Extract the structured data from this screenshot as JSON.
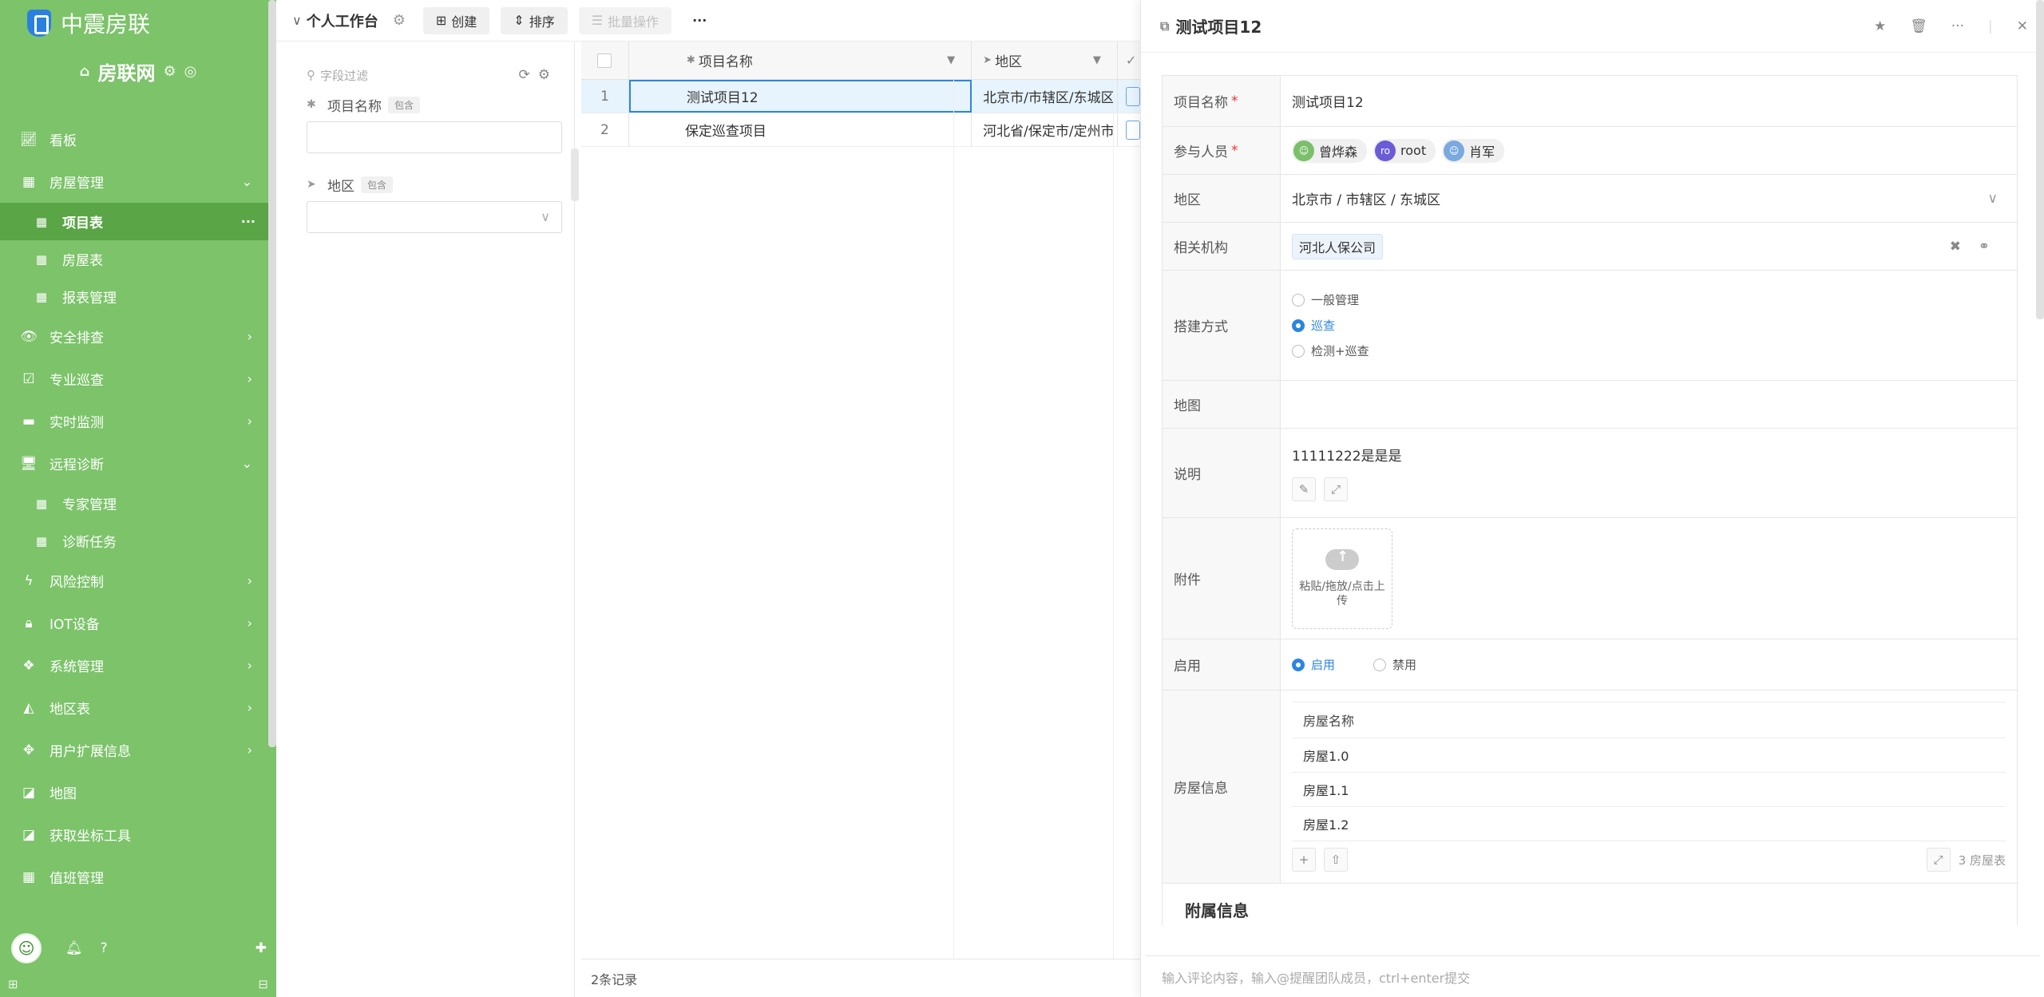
{
  "brand": {
    "name": "中震房联",
    "site": "房联网"
  },
  "sidebar": {
    "items": [
      {
        "label": "看板",
        "icon": "chart-line-icon"
      },
      {
        "label": "房屋管理",
        "icon": "calendar-icon",
        "arrow": "∨"
      },
      {
        "label": "项目表",
        "icon": "table-icon",
        "sub": true,
        "active": true
      },
      {
        "label": "房屋表",
        "icon": "table-icon",
        "sub": true
      },
      {
        "label": "报表管理",
        "icon": "table-icon",
        "sub": true
      },
      {
        "label": "安全排查",
        "icon": "eye-icon",
        "arrow": ">"
      },
      {
        "label": "专业巡查",
        "icon": "calendar-check-icon",
        "arrow": ">"
      },
      {
        "label": "实时监测",
        "icon": "monitor-icon",
        "arrow": ">"
      },
      {
        "label": "远程诊断",
        "icon": "desktop-icon",
        "arrow": "∨"
      },
      {
        "label": "专家管理",
        "icon": "table-icon",
        "sub": true
      },
      {
        "label": "诊断任务",
        "icon": "table-icon",
        "sub": true
      },
      {
        "label": "风险控制",
        "icon": "bolt-icon",
        "arrow": ">"
      },
      {
        "label": "IOT设备",
        "icon": "lock-icon",
        "arrow": ">"
      },
      {
        "label": "系统管理",
        "icon": "cubes-icon",
        "arrow": ">"
      },
      {
        "label": "地区表",
        "icon": "area-chart-icon",
        "arrow": ">"
      },
      {
        "label": "用户扩展信息",
        "icon": "arrows-icon",
        "arrow": ">"
      },
      {
        "label": "地图",
        "icon": "map-icon"
      },
      {
        "label": "获取坐标工具",
        "icon": "map-icon"
      },
      {
        "label": "值班管理",
        "icon": "table-icon"
      }
    ]
  },
  "toolbar": {
    "title": "个人工作台",
    "create": "创建",
    "sort": "排序",
    "batch": "批量操作",
    "more": "···"
  },
  "filter": {
    "placeholder": "字段过滤",
    "field1": {
      "label": "项目名称",
      "tag": "包含"
    },
    "field2": {
      "label": "地区",
      "tag": "包含"
    }
  },
  "grid": {
    "columns": [
      "项目名称",
      "地区"
    ],
    "rows": [
      {
        "no": "1",
        "name": "测试项目12",
        "region": "北京市/市辖区/东城区"
      },
      {
        "no": "2",
        "name": "保定巡查项目",
        "region": "河北省/保定市/定州市"
      }
    ],
    "footer": "2条记录"
  },
  "detail": {
    "title": "测试项目12",
    "labels": {
      "name": "项目名称",
      "members": "参与人员",
      "region": "地区",
      "org": "相关机构",
      "mode": "搭建方式",
      "map": "地图",
      "desc": "说明",
      "attach": "附件",
      "enable": "启用",
      "houses": "房屋信息"
    },
    "name": "测试项目12",
    "members": [
      {
        "name": "曾烨森",
        "color": "#7bbf6a",
        "initials": ""
      },
      {
        "name": "root",
        "color": "#6b5bd6",
        "initials": "ro"
      },
      {
        "name": "肖军",
        "color": "#7aa8e0",
        "initials": ""
      }
    ],
    "region": "北京市 / 市辖区 / 东城区",
    "org": "河北人保公司",
    "mode_options": [
      "一般管理",
      "巡查",
      "检测+巡查"
    ],
    "mode_selected": 1,
    "desc": "11111222是是是",
    "upload": "粘贴/拖放/点击上传",
    "enable_on": "启用",
    "enable_off": "禁用",
    "house_header": "房屋名称",
    "houses": [
      "房屋1.0",
      "房屋1.1",
      "房屋1.2"
    ],
    "house_count": "3 房屋表",
    "section": "附属信息",
    "comment_placeholder": "输入评论内容，输入@提醒团队成员，ctrl+enter提交"
  },
  "colors": {
    "sidebar": "#7cc36a",
    "accent": "#2c86e0"
  }
}
